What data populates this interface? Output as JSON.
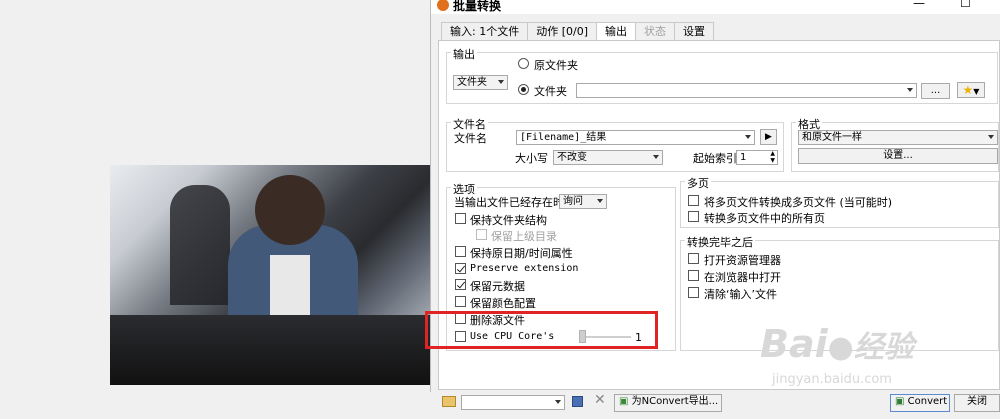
{
  "window": {
    "title": "批量转换"
  },
  "tabs": [
    {
      "label": "输入: 1个文件",
      "state": "normal"
    },
    {
      "label": "动作 [0/0]",
      "state": "normal"
    },
    {
      "label": "输出",
      "state": "active"
    },
    {
      "label": "状态",
      "state": "disabled"
    },
    {
      "label": "设置",
      "state": "normal"
    }
  ],
  "output": {
    "group_label": "输出",
    "folder_combo": "文件夹",
    "radio_original": "原文件夹",
    "radio_folder": "文件夹",
    "path_value": "",
    "browse_label": "..."
  },
  "filename": {
    "group_label": "文件名",
    "name_label": "文件名",
    "name_value": "[Filename]_结果",
    "case_label": "大小写",
    "case_value": "不改变",
    "start_index_label": "起始索引",
    "start_index_value": "1"
  },
  "format": {
    "group_label": "格式",
    "format_value": "和原文件一样",
    "settings_button": "设置..."
  },
  "options": {
    "group_label": "选项",
    "exists_label": "当输出文件已经存在时",
    "exists_value": "询问",
    "items": [
      {
        "label": "保持文件夹结构",
        "checked": false,
        "disabled": false
      },
      {
        "label": "保留上级目录",
        "checked": false,
        "disabled": true
      },
      {
        "label": "保持原日期/时间属性",
        "checked": false,
        "disabled": false
      },
      {
        "label": "Preserve extension",
        "checked": true,
        "disabled": false
      },
      {
        "label": "保留元数据",
        "checked": true,
        "disabled": false
      },
      {
        "label": "保留颜色配置",
        "checked": false,
        "disabled": false
      },
      {
        "label": "删除源文件",
        "checked": false,
        "disabled": false
      },
      {
        "label": "Use CPU Core's",
        "checked": false,
        "disabled": false
      }
    ],
    "cpu_cores_value": "1",
    "cpu_cores_fraction": 0.0
  },
  "multipage": {
    "group_label": "多页",
    "items": [
      {
        "label": "将多页文件转换成多页文件 (当可能时)",
        "checked": false
      },
      {
        "label": "转换多页文件中的所有页",
        "checked": false
      }
    ]
  },
  "after": {
    "group_label": "转换完毕之后",
    "items": [
      {
        "label": "打开资源管理器",
        "checked": false
      },
      {
        "label": "在浏览器中打开",
        "checked": false
      },
      {
        "label": "清除‘输入’文件",
        "checked": false
      }
    ]
  },
  "bottom": {
    "preset_value": "",
    "export_button": "为NConvert导出...",
    "convert_button": "Convert",
    "close_button": "关闭"
  },
  "watermark": {
    "brand": "Bai",
    "brand2": "经验",
    "url": "jingyan.baidu.com"
  },
  "colors": {
    "highlight": "#e02424",
    "accent": "#e06f1e"
  }
}
